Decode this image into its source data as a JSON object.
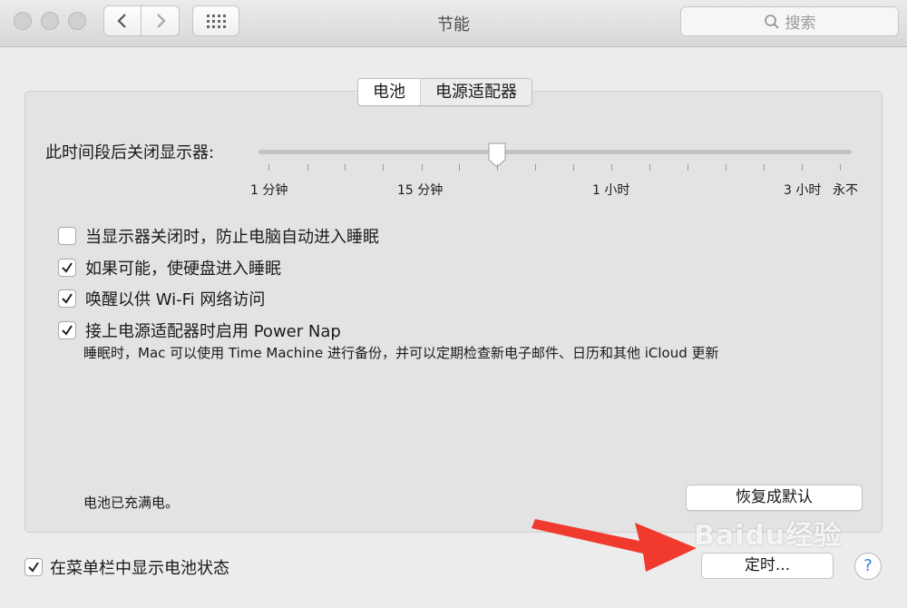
{
  "window": {
    "title": "节能"
  },
  "toolbar": {
    "search_placeholder": "搜索",
    "icons": [
      "back-chevron-icon",
      "forward-chevron-icon",
      "grid-icon",
      "search-icon"
    ]
  },
  "tabs": [
    {
      "label": "电池",
      "selected": true
    },
    {
      "label": "电源适配器",
      "selected": false
    }
  ],
  "display_sleep": {
    "label": "此时间段后关闭显示器:",
    "ticks": [
      "1 分钟",
      "15 分钟",
      "1 小时",
      "3 小时",
      "永不"
    ],
    "slider_value": "15 分钟 to 1 小时 region"
  },
  "options": [
    {
      "label": "当显示器关闭时，防止电脑自动进入睡眠",
      "checked": false
    },
    {
      "label": "如果可能，使硬盘进入睡眠",
      "checked": true
    },
    {
      "label": "唤醒以供 Wi-Fi 网络访问",
      "checked": true
    },
    {
      "label": "接上电源适配器时启用 Power Nap",
      "checked": true
    }
  ],
  "power_nap_desc": "睡眠时，Mac 可以使用 Time Machine 进行备份，并可以定期检查新电子邮件、日历和其他 iCloud 更新",
  "battery_status": "电池已充满电。",
  "restore_defaults": "恢复成默认",
  "show_battery_status": {
    "label": "在菜单栏中显示电池状态",
    "checked": true
  },
  "schedule_button": "定时...",
  "help_button": "?",
  "watermark": "Baidu经验",
  "colors": {
    "arrow": "#f03a2e",
    "help": "#2f7ae5"
  }
}
